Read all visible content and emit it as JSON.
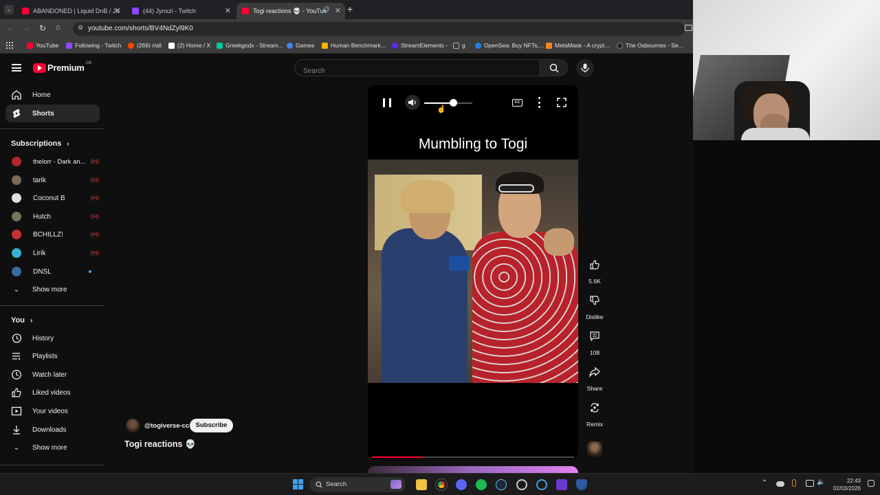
{
  "browser": {
    "tabs": [
      {
        "title": "ABANDONED | Liquid DnB / Ju",
        "color": "#ff0033",
        "active": false
      },
      {
        "title": "(44) Jynxzi - Twitch",
        "color": "#9146ff",
        "active": false
      },
      {
        "title": "Togi reactions 💀 - YouTub",
        "color": "#ff0033",
        "active": true
      }
    ],
    "url": "youtube.com/shorts/BV4NdZyl9K0",
    "bookmarks": [
      {
        "label": "YouTube",
        "color": "#ff0033"
      },
      {
        "label": "Following - Twitch",
        "color": "#9146ff"
      },
      {
        "label": "(269) r/all",
        "color": "#ff4500"
      },
      {
        "label": "(2) Home / X",
        "color": "#ffffff"
      },
      {
        "label": "Greekgodx - Stream...",
        "color": "#00c8a0"
      },
      {
        "label": "Games",
        "color": "#4285f4"
      },
      {
        "label": "Human Benchmark...",
        "color": "#f0b400"
      },
      {
        "label": "StreamElements -",
        "color": "#5b2bf0"
      },
      {
        "label": "g",
        "color": "#9aa0a6"
      },
      {
        "label": "OpenSea: Buy NFTs,...",
        "color": "#2081e2"
      },
      {
        "label": "MetaMask - A crypt...",
        "color": "#f6851b"
      },
      {
        "label": "The Osbournes - Se...",
        "color": "#222222"
      }
    ]
  },
  "header": {
    "logo_text": "Premium",
    "logo_badge": "GB",
    "search_placeholder": "Search"
  },
  "sidebar": {
    "main": [
      {
        "label": "Home",
        "icon": "home-icon"
      },
      {
        "label": "Shorts",
        "icon": "shorts-icon",
        "selected": true
      }
    ],
    "subscriptions_title": "Subscriptions",
    "subscriptions": [
      {
        "label": "thelorr - Dark an...",
        "color": "#b3262c",
        "live": true
      },
      {
        "label": "tarik",
        "color": "#7a6a5a",
        "live": true
      },
      {
        "label": "Coconut B",
        "color": "#e0e0e0",
        "live": true
      },
      {
        "label": "Hutch",
        "color": "#6a7a5a",
        "live": true
      },
      {
        "label": "BCHILLZ!",
        "color": "#c83232",
        "live": true
      },
      {
        "label": "Lirik",
        "color": "#3ab0d0",
        "live": true
      },
      {
        "label": "DNSL",
        "color": "#3a6aa0",
        "live": false,
        "dot": true
      }
    ],
    "show_more": "Show more",
    "you_title": "You",
    "you": [
      {
        "label": "History",
        "icon": "history-icon"
      },
      {
        "label": "Playlists",
        "icon": "playlists-icon"
      },
      {
        "label": "Watch later",
        "icon": "watch-later-icon"
      },
      {
        "label": "Liked videos",
        "icon": "like-icon"
      },
      {
        "label": "Your videos",
        "icon": "your-videos-icon"
      },
      {
        "label": "Downloads",
        "icon": "download-icon"
      }
    ],
    "show_more_2": "Show more"
  },
  "short": {
    "caption": "Mumbling to Togi",
    "channel": "@togiverse-cc",
    "subscribe": "Subscribe",
    "title": "Togi reactions 💀",
    "volume": 0.6,
    "progress": 0.25,
    "actions": [
      {
        "label": "5.6K",
        "icon": "like-icon"
      },
      {
        "label": "Dislike",
        "icon": "dislike-icon"
      },
      {
        "label": "108",
        "icon": "comment-icon"
      },
      {
        "label": "Share",
        "icon": "share-icon"
      },
      {
        "label": "Remix",
        "icon": "remix-icon"
      }
    ]
  },
  "taskbar": {
    "search": "Search",
    "time": "22:43",
    "date": "02/03/2026"
  }
}
